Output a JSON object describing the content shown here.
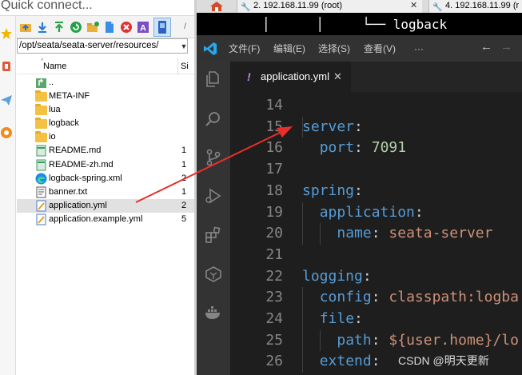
{
  "file_manager": {
    "quick_connect_text": "Quick connect...",
    "path": "/opt/seata/seata-server/resources/",
    "columns": {
      "name": "Name",
      "size": "Si"
    },
    "files": [
      {
        "name": "..",
        "type": "parent",
        "size": ""
      },
      {
        "name": "META-INF",
        "type": "folder",
        "size": ""
      },
      {
        "name": "lua",
        "type": "folder",
        "size": ""
      },
      {
        "name": "logback",
        "type": "folder",
        "size": ""
      },
      {
        "name": "io",
        "type": "folder",
        "size": ""
      },
      {
        "name": "README.md",
        "type": "file",
        "size": "1"
      },
      {
        "name": "README-zh.md",
        "type": "file",
        "size": "1"
      },
      {
        "name": "logback-spring.xml",
        "type": "edge-xml",
        "size": "2"
      },
      {
        "name": "banner.txt",
        "type": "text",
        "size": "1"
      },
      {
        "name": "application.yml",
        "type": "yml",
        "size": "2",
        "selected": true
      },
      {
        "name": "application.example.yml",
        "type": "yml",
        "size": "5"
      }
    ]
  },
  "terminal": {
    "tabs": [
      {
        "label": "2. 192.168.11.99 (root)"
      },
      {
        "label": "4. 192.168.11.99 (r"
      }
    ],
    "tree_line": "│      │     └── logback"
  },
  "vscode": {
    "menu": [
      "文件(F)",
      "编辑(E)",
      "选择(S)",
      "查看(V)",
      "···"
    ],
    "active_tab": {
      "modified_mark": "!",
      "filename": "application.yml",
      "close": "✕"
    },
    "lines": [
      {
        "num": "14",
        "tokens": []
      },
      {
        "num": "15",
        "tokens": [
          {
            "t": "server",
            "c": "k"
          },
          {
            "t": ":",
            "c": "p"
          }
        ]
      },
      {
        "num": "16",
        "tokens": [
          {
            "t": "  ",
            "c": "p"
          },
          {
            "t": "port",
            "c": "k"
          },
          {
            "t": ": ",
            "c": "p"
          },
          {
            "t": "7091",
            "c": "n"
          }
        ]
      },
      {
        "num": "17",
        "tokens": []
      },
      {
        "num": "18",
        "tokens": [
          {
            "t": "spring",
            "c": "k"
          },
          {
            "t": ":",
            "c": "p"
          }
        ]
      },
      {
        "num": "19",
        "tokens": [
          {
            "t": "  ",
            "c": "p"
          },
          {
            "t": "application",
            "c": "k"
          },
          {
            "t": ":",
            "c": "p"
          }
        ]
      },
      {
        "num": "20",
        "tokens": [
          {
            "t": "    ",
            "c": "p"
          },
          {
            "t": "name",
            "c": "k"
          },
          {
            "t": ": ",
            "c": "p"
          },
          {
            "t": "seata-server",
            "c": "s"
          }
        ]
      },
      {
        "num": "21",
        "tokens": []
      },
      {
        "num": "22",
        "tokens": [
          {
            "t": "logging",
            "c": "k"
          },
          {
            "t": ":",
            "c": "p"
          }
        ]
      },
      {
        "num": "23",
        "tokens": [
          {
            "t": "  ",
            "c": "p"
          },
          {
            "t": "config",
            "c": "k"
          },
          {
            "t": ": ",
            "c": "p"
          },
          {
            "t": "classpath:logba",
            "c": "s"
          }
        ]
      },
      {
        "num": "24",
        "tokens": [
          {
            "t": "  ",
            "c": "p"
          },
          {
            "t": "file",
            "c": "k"
          },
          {
            "t": ":",
            "c": "p"
          }
        ]
      },
      {
        "num": "25",
        "tokens": [
          {
            "t": "    ",
            "c": "p"
          },
          {
            "t": "path",
            "c": "k"
          },
          {
            "t": ": ",
            "c": "p"
          },
          {
            "t": "${user.home}/lo",
            "c": "s"
          }
        ]
      },
      {
        "num": "26",
        "tokens": [
          {
            "t": "  ",
            "c": "p"
          },
          {
            "t": "extend",
            "c": "k"
          },
          {
            "t": ":",
            "c": "p"
          }
        ]
      }
    ]
  },
  "watermark": "CSDN @明天更新",
  "colors": {
    "keyword": "#569cd6",
    "number": "#b5cea8",
    "string": "#ce9178",
    "annotation_arrow": "#e8302a"
  }
}
